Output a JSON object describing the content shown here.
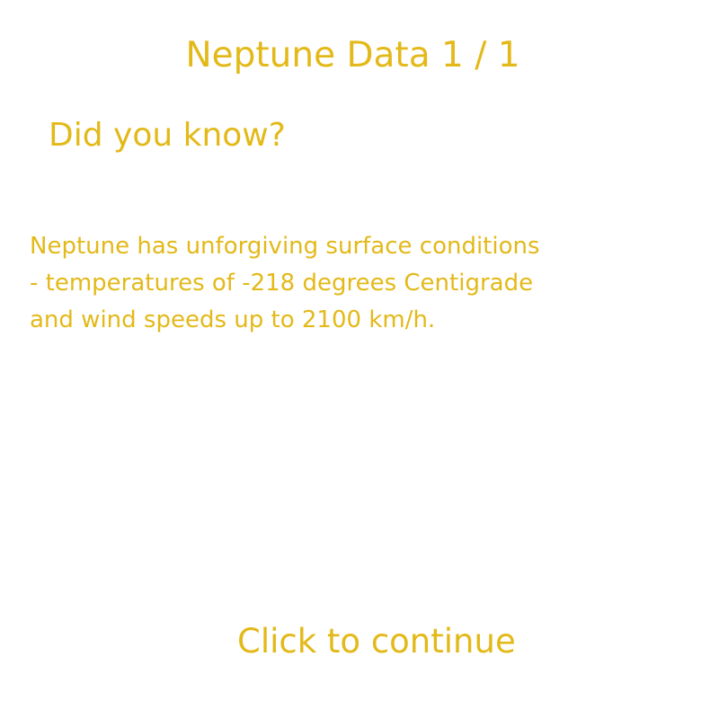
{
  "screen": {
    "title": "Neptune Data 1 / 1",
    "subtitle": "Did you know?",
    "body_lines": [
      "Neptune has unforgiving surface conditions",
      "- temperatures of -218 degrees Centigrade",
      "and wind speeds up to 2100 km/h."
    ],
    "continue_label": "Click to continue"
  },
  "colors": {
    "text": "#E3B919",
    "background": "#FFFFFF"
  }
}
